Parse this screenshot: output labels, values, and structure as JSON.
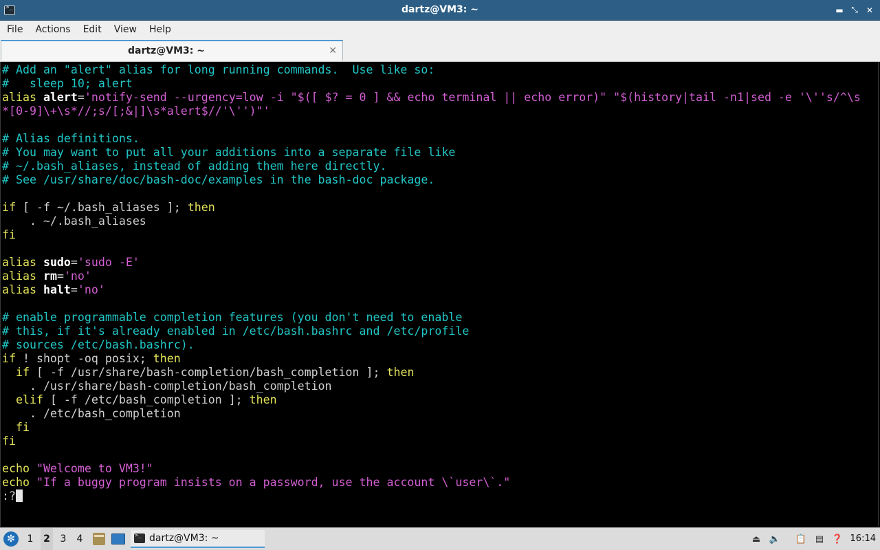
{
  "window": {
    "title": "dartz@VM3: ~",
    "icon": "terminal-icon",
    "buttons": [
      "minimize-icon",
      "maximize-icon",
      "close-icon"
    ]
  },
  "menu": {
    "file": "File",
    "actions": "Actions",
    "edit": "Edit",
    "view": "View",
    "help": "Help"
  },
  "tab": {
    "label": "dartz@VM3: ~",
    "close": "✕"
  },
  "terminal": {
    "lines": [
      [
        [
          "comment",
          "# Add an \"alert\" alias for long running commands.  Use like so:"
        ]
      ],
      [
        [
          "comment",
          "#   sleep 10; alert"
        ]
      ],
      [
        [
          "kw",
          "alias "
        ],
        [
          "name",
          "alert"
        ],
        [
          "norm",
          "="
        ],
        [
          "str",
          "'notify-send --urgency=low -i \"$([ $? = 0 ] && echo terminal || echo error)\" \"$(history|tail -n1|sed -e '\\''s/^\\s"
        ]
      ],
      [
        [
          "str",
          "*[0-9]\\+\\s*//;s/[;&|]\\s*alert$//'\\'')\"'"
        ]
      ],
      [],
      [
        [
          "comment",
          "# Alias definitions."
        ]
      ],
      [
        [
          "comment",
          "# You may want to put all your additions into a separate file like"
        ]
      ],
      [
        [
          "comment",
          "# ~/.bash_aliases, instead of adding them here directly."
        ]
      ],
      [
        [
          "comment",
          "# See /usr/share/doc/bash-doc/examples in the bash-doc package."
        ]
      ],
      [],
      [
        [
          "kw",
          "if"
        ],
        [
          "norm",
          " [ -f ~/.bash_aliases ]; "
        ],
        [
          "kw",
          "then"
        ]
      ],
      [
        [
          "norm",
          "    . ~/.bash_aliases"
        ]
      ],
      [
        [
          "kw",
          "fi"
        ]
      ],
      [],
      [
        [
          "kw",
          "alias "
        ],
        [
          "name",
          "sudo"
        ],
        [
          "norm",
          "="
        ],
        [
          "str",
          "'sudo -E'"
        ]
      ],
      [
        [
          "kw",
          "alias "
        ],
        [
          "name",
          "rm"
        ],
        [
          "norm",
          "="
        ],
        [
          "str",
          "'no'"
        ]
      ],
      [
        [
          "kw",
          "alias "
        ],
        [
          "name",
          "halt"
        ],
        [
          "norm",
          "="
        ],
        [
          "str",
          "'no'"
        ]
      ],
      [],
      [
        [
          "comment",
          "# enable programmable completion features (you don't need to enable"
        ]
      ],
      [
        [
          "comment",
          "# this, if it's already enabled in /etc/bash.bashrc and /etc/profile"
        ]
      ],
      [
        [
          "comment",
          "# sources /etc/bash.bashrc)."
        ]
      ],
      [
        [
          "kw",
          "if"
        ],
        [
          "norm",
          " ! shopt -oq posix; "
        ],
        [
          "kw",
          "then"
        ]
      ],
      [
        [
          "norm",
          "  "
        ],
        [
          "kw",
          "if"
        ],
        [
          "norm",
          " [ -f /usr/share/bash-completion/bash_completion ]; "
        ],
        [
          "kw",
          "then"
        ]
      ],
      [
        [
          "norm",
          "    . /usr/share/bash-completion/bash_completion"
        ]
      ],
      [
        [
          "norm",
          "  "
        ],
        [
          "kw",
          "elif"
        ],
        [
          "norm",
          " [ -f /etc/bash_completion ]; "
        ],
        [
          "kw",
          "then"
        ]
      ],
      [
        [
          "norm",
          "    . /etc/bash_completion"
        ]
      ],
      [
        [
          "norm",
          "  "
        ],
        [
          "kw",
          "fi"
        ]
      ],
      [
        [
          "kw",
          "fi"
        ]
      ],
      [],
      [
        [
          "kw",
          "echo "
        ],
        [
          "str",
          "\"Welcome to VM3!\""
        ]
      ],
      [
        [
          "kw",
          "echo "
        ],
        [
          "str",
          "\"If a buggy program insists on a password, use the account \\`user\\`.\""
        ]
      ]
    ],
    "prompt": ":?"
  },
  "taskbar": {
    "start_icon": "menu-logo-icon",
    "desktops": [
      "1",
      "2",
      "3",
      "4"
    ],
    "active_desktop": "2",
    "task_label": "dartz@VM3: ~",
    "tray_icons": [
      "eject-icon",
      "volume-icon",
      "clipboard-icon",
      "network-icon",
      "update-notifier-icon"
    ],
    "clock": "16:14"
  },
  "colors": {
    "titlebar": "#2d5f86",
    "comment": "#22c6c6",
    "keyword": "#e3e35a",
    "string": "#d25fd2",
    "accent": "#4e9ad4"
  }
}
